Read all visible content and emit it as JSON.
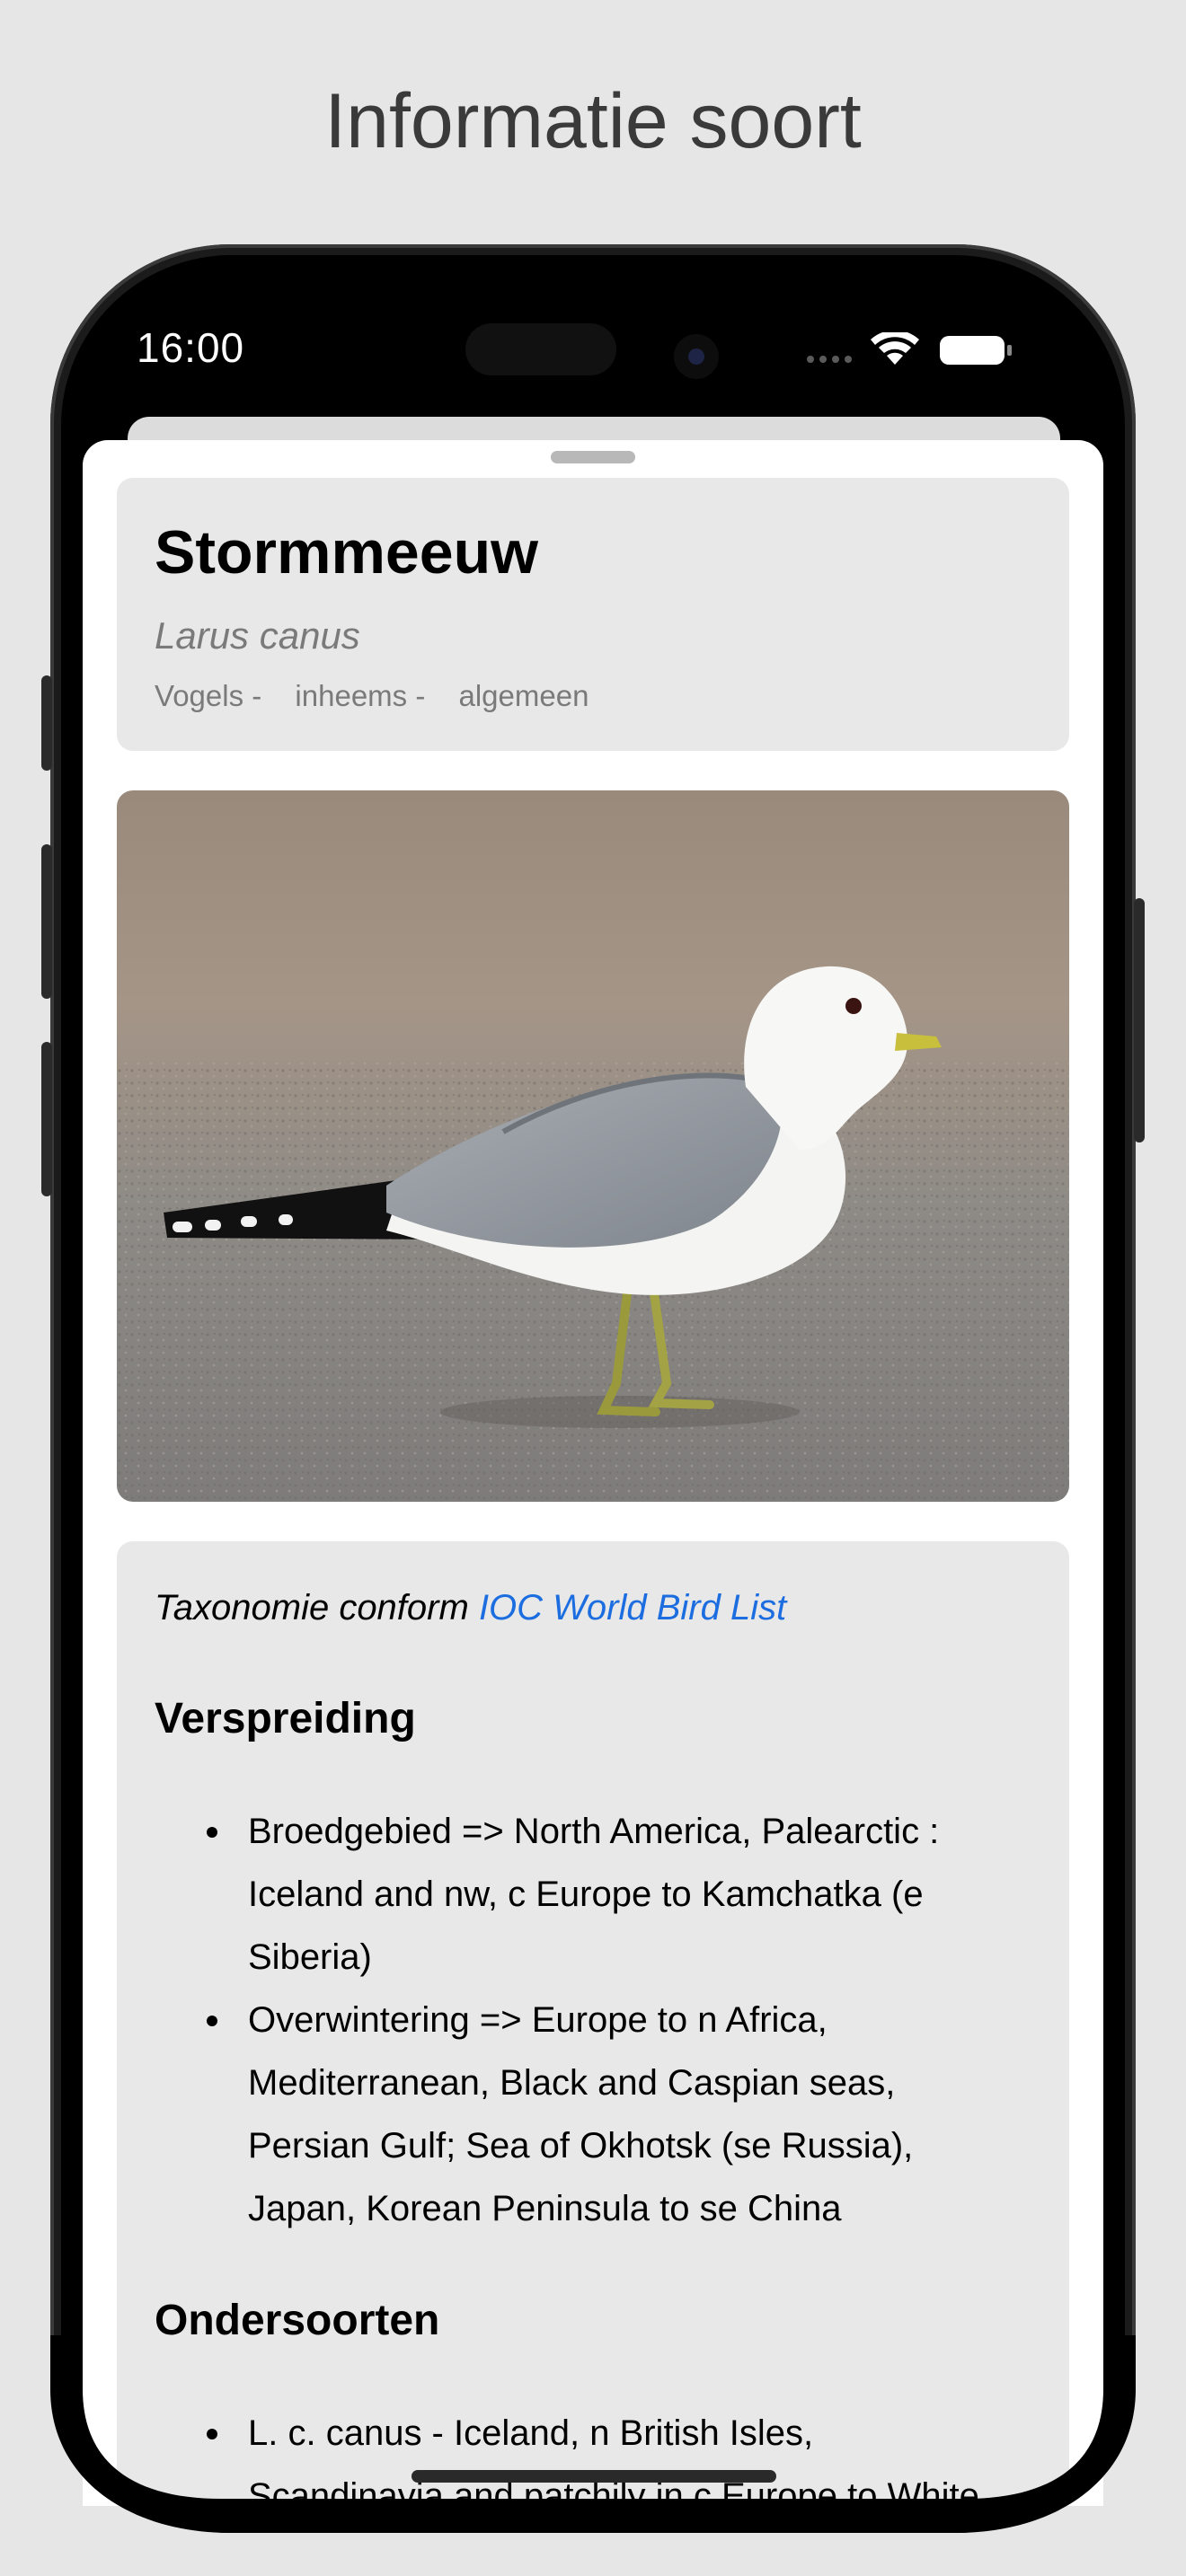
{
  "page": {
    "title": "Informatie soort"
  },
  "status_bar": {
    "time": "16:00",
    "icons": [
      "signal-icon",
      "wifi-icon",
      "battery-icon"
    ]
  },
  "species": {
    "name": "Stormmeeuw",
    "latin": "Larus canus",
    "tags": [
      "Vogels -",
      "inheems -",
      "algemeen"
    ]
  },
  "photo": {
    "subject": "gull-photo"
  },
  "taxonomy": {
    "prefix": "Taxonomie conform",
    "link_label": "IOC World Bird List"
  },
  "verspreiding": {
    "heading": "Verspreiding",
    "items": [
      "Broedgebied => North America, Palearctic : Iceland and nw, c Europe to Kamchatka (e Siberia)",
      "Overwintering => Europe to n Africa, Mediterranean, Black and Caspian seas, Persian Gulf; Sea of Okhotsk (se Russia), Japan, Korean Peninsula to se China"
    ]
  },
  "ondersoorten": {
    "heading": "Ondersoorten",
    "items": [
      "L. c. canus - Iceland, n British Isles, Scandinavia and patchily in c Europe to White"
    ]
  },
  "colors": {
    "link": "#1b6de0",
    "card": "#e8e8e8",
    "background": "#e6e6e6"
  }
}
